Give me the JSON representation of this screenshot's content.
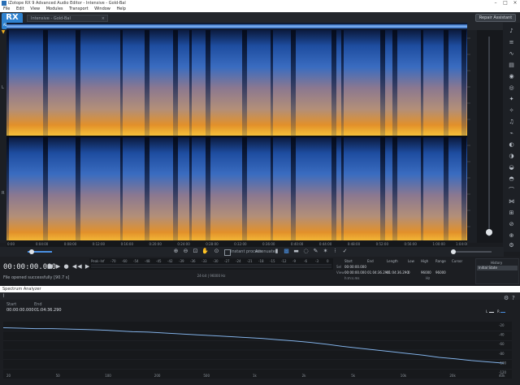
{
  "window": {
    "title": "iZotope RX 9 Advanced Audio Editor - Intensive - Gold-Bal"
  },
  "menu": [
    "File",
    "Edit",
    "View",
    "Modules",
    "Transport",
    "Window",
    "Help"
  ],
  "logo": {
    "big": "RX",
    "small": "ADVANCED"
  },
  "file_tab": {
    "label": "Intensive - Gold-Bal"
  },
  "repair_assistant": {
    "label": "Repair Assistant"
  },
  "channels": [
    "L",
    "R"
  ],
  "time_ticks": [
    "0:00",
    "0:01:00",
    "0:02:00",
    "0:03:00",
    "0:04:00",
    "0:05:00",
    "0:06:00",
    "0:07:00",
    "0:08:00",
    "0:09:00",
    "0:10:00",
    "0:11:00",
    "0:12:00",
    "0:13:00",
    "0:14:00",
    "0:15:00",
    "0:16:00",
    "0:17:00",
    "0:18:00",
    "0:19:00",
    "0:20:00",
    "0:21:00",
    "0:22:00",
    "0:23:00",
    "0:24:00",
    "0:25:00",
    "0:26:00",
    "0:27:00",
    "0:28:00",
    "0:29:00",
    "0:30:00",
    "0:31:00",
    "0:32:00",
    "0:33:00",
    "0:34:00",
    "0:35:00",
    "0:36:00",
    "0:37:00",
    "0:38:00",
    "0:39:00",
    "0:40:00",
    "0:41:00",
    "0:42:00",
    "0:43:00",
    "0:44:00",
    "0:45:00",
    "0:46:00",
    "0:47:00",
    "0:48:00",
    "0:49:00",
    "0:50:00",
    "0:51:00",
    "0:52:00",
    "0:53:00",
    "0:54:00",
    "0:55:00",
    "0:56:00",
    "0:57:00",
    "0:58:00",
    "0:59:00",
    "1:00:00",
    "1:01:00",
    "1:02:00",
    "1:03:00",
    "1:04:00",
    "1:05:00"
  ],
  "toolrow": {
    "instant_process": "Instant process",
    "mode": "Attenuate"
  },
  "transport": {
    "timecode": "00:00:00.000",
    "status": "File opened successfully [90.7 s]",
    "format": "24-bit | 96000 Hz",
    "meter_label": "Peak",
    "meter_ticks": [
      "-Inf",
      "-70",
      "-60",
      "-54",
      "-48",
      "-45",
      "-42",
      "-39",
      "-36",
      "-33",
      "-30",
      "-27",
      "-24",
      "-21",
      "-18",
      "-15",
      "-12",
      "-9",
      "-6",
      "-3",
      "0"
    ]
  },
  "selection": {
    "headers": [
      "Start",
      "End",
      "Length",
      "Low",
      "High",
      "Range",
      "Cursor"
    ],
    "sel_label": "Sel",
    "view_label": "View",
    "sel": [
      "00:00:00.000",
      "",
      "",
      "",
      "",
      "",
      ""
    ],
    "view": [
      "00:00:00.000",
      "01:04:36.290",
      "01:04:36.290",
      "0",
      "96000",
      "96000",
      ""
    ],
    "time_format": "h:m:s.ms",
    "freq_unit": "Hz"
  },
  "history": {
    "title": "History",
    "item": "Initial State"
  },
  "analyzer": {
    "title": "Spectrum Analyzer",
    "start_label": "Start",
    "end_label": "End",
    "start": "00:00:00.000",
    "end": "01:04:36.290",
    "legend": [
      "L",
      "R"
    ],
    "freq_labels": [
      "20",
      "50",
      "100",
      "200",
      "500",
      "1k",
      "2k",
      "5k",
      "10k",
      "20k",
      "40k"
    ],
    "db_labels": [
      "-20",
      "-40",
      "-60",
      "-80",
      "-100",
      "-120"
    ],
    "curve": [
      0.1,
      0.11,
      0.12,
      0.12,
      0.13,
      0.14,
      0.15,
      0.17,
      0.19,
      0.2,
      0.22,
      0.24,
      0.26,
      0.28,
      0.3,
      0.32,
      0.34,
      0.37,
      0.4,
      0.43,
      0.47,
      0.52,
      0.56,
      0.6,
      0.64,
      0.68,
      0.72,
      0.77,
      0.8,
      0.84,
      0.87,
      0.9
    ]
  },
  "colors": {
    "accent": "#2f82cf",
    "spectro_hot": "#f0a020",
    "spectro_mid": "#9a7a7a",
    "spectro_cold": "#2a5fb0"
  }
}
